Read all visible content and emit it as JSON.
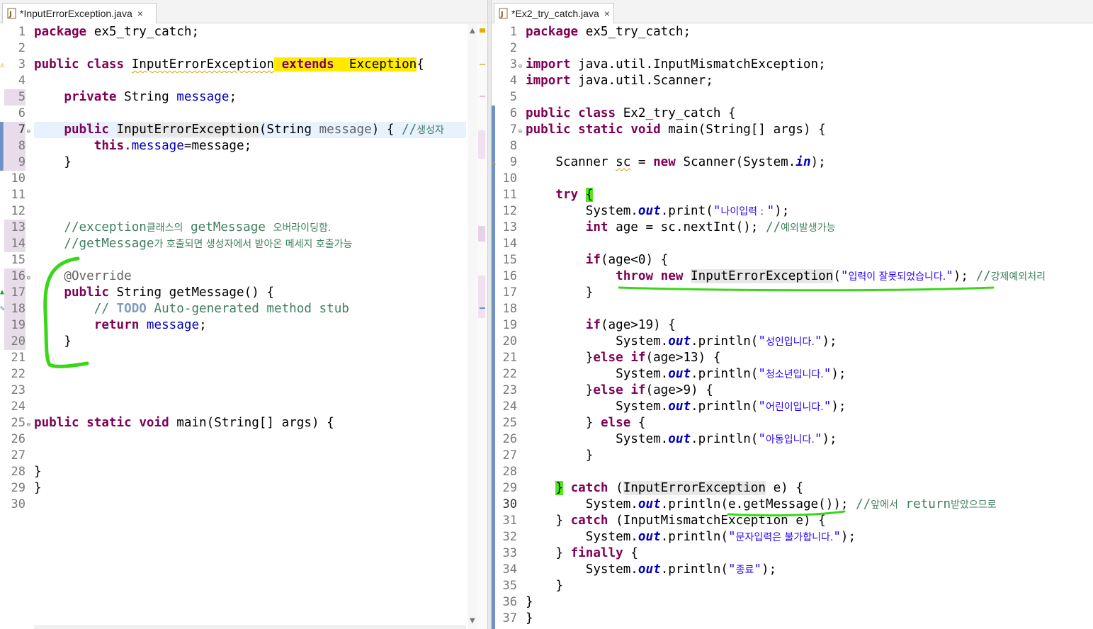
{
  "colors": {
    "keyword": "#7f0055",
    "field": "#0000c0",
    "comment": "#3f7f5f",
    "string": "#2a00ff",
    "annotation_highlight": "#50e81c",
    "occurrence_highlight": "#ffea00"
  },
  "left": {
    "tab": {
      "title": "*InputErrorException.java",
      "icon": "java-file-icon",
      "close": "×"
    },
    "line_numbers": [
      "1",
      "2",
      "3",
      "4",
      "5",
      "6",
      "7",
      "8",
      "9",
      "10",
      "11",
      "12",
      "13",
      "14",
      "15",
      "16",
      "17",
      "18",
      "19",
      "20",
      "21",
      "22",
      "23",
      "24",
      "25",
      "26",
      "27",
      "28",
      "29",
      "30"
    ],
    "code": {
      "l1_kw": "package",
      "l1_rest": " ex5_try_catch;",
      "l3_kw1": "public",
      "l3_kw2": "class",
      "l3_name": "InputErrorException",
      "l3_extends": "extends",
      "l3_exc": "Exception",
      "l3_brace": "{",
      "l5_kw": "private",
      "l5_type": " String ",
      "l5_field": "message",
      "l5_end": ";",
      "l7_kw": "public",
      "l7_name": "InputErrorException",
      "l7_params": "(String ",
      "l7_param": "message",
      "l7_close": ") { ",
      "l7_comment_slash": "//",
      "l7_comment_ko": "생성자",
      "l8_this": "this",
      "l8_dot": ".",
      "l8_field": "message",
      "l8_eq": "=message;",
      "l9": "}",
      "l13_prefix": "//exception",
      "l13_ko1": "클래스의",
      "l13_mid": " getMessage ",
      "l13_ko2": "오버라이딩함.",
      "l14_prefix": "//getMessage",
      "l14_ko": "가 호출되면 생성자에서 받아온 메세지 호출가능",
      "l16": "@Override",
      "l17_kw": "public",
      "l17_rest": " String getMessage() {",
      "l18_slash": "// ",
      "l18_todo": "TODO",
      "l18_rest": " Auto-generated method stub",
      "l19_kw": "return",
      "l19_field": "message",
      "l19_end": ";",
      "l20": "}",
      "l25_kw1": "public",
      "l25_kw2": "static",
      "l25_kw3": "void",
      "l25_rest": " main(String[] args) {",
      "l28": "}",
      "l29": "}"
    }
  },
  "right": {
    "tab": {
      "title": "*Ex2_try_catch.java",
      "icon": "java-file-icon",
      "close": "×"
    },
    "line_numbers": [
      "1",
      "2",
      "3",
      "4",
      "5",
      "6",
      "7",
      "8",
      "9",
      "10",
      "11",
      "12",
      "13",
      "14",
      "15",
      "16",
      "17",
      "18",
      "19",
      "20",
      "21",
      "22",
      "23",
      "24",
      "25",
      "26",
      "27",
      "28",
      "29",
      "30",
      "31",
      "32",
      "33",
      "34",
      "35",
      "36",
      "37"
    ],
    "code": {
      "l1_kw": "package",
      "l1_rest": " ex5_try_catch;",
      "l3_kw": "import",
      "l3_rest": " java.util.InputMismatchException;",
      "l4_kw": "import",
      "l4_rest": " java.util.Scanner;",
      "l6_kw1": "public",
      "l6_kw2": "class",
      "l6_rest": " Ex2_try_catch {",
      "l7_kw1": "public",
      "l7_kw2": "static",
      "l7_kw3": "void",
      "l7_rest": " main(String[] args) {",
      "l9_a": "Scanner ",
      "l9_var": "sc",
      "l9_b": " = ",
      "l9_new": "new",
      "l9_c": " Scanner(System.",
      "l9_in": "in",
      "l9_d": ");",
      "l11_try": "try",
      "l11_brace": "{",
      "l12_a": "System.",
      "l12_out": "out",
      "l12_b": ".print(",
      "l12_str_q": "\"",
      "l12_str_ko": "나이입력 : ",
      "l12_str_q2": "\"",
      "l12_c": ");",
      "l13_kw": "int",
      "l13_a": " age = sc.nextInt(); ",
      "l13_slash": "//",
      "l13_ko": "예외발생가능",
      "l15_kw": "if",
      "l15_a": "(age<0) {",
      "l16_kw1": "throw",
      "l16_kw2": "new",
      "l16_name": "InputErrorException",
      "l16_open": "(",
      "l16_q": "\"",
      "l16_ko": "입력이 잘못되었습니다.",
      "l16_q2": "\"",
      "l16_close": "); ",
      "l16_slash": "//",
      "l16_cko": "강제예외처리",
      "l17": "}",
      "l19_kw": "if",
      "l19_a": "(age>19) {",
      "l20_a": "System.",
      "l20_out": "out",
      "l20_b": ".println(",
      "l20_q": "\"",
      "l20_ko": "성인입니다.",
      "l20_q2": "\"",
      "l20_c": ");",
      "l21_a": "}",
      "l21_kw1": "else",
      "l21_kw2": "if",
      "l21_b": "(age>13) {",
      "l22_a": "System.",
      "l22_out": "out",
      "l22_b": ".println(",
      "l22_q": "\"",
      "l22_ko": "청소년입니다.",
      "l22_q2": "\"",
      "l22_c": ");",
      "l23_a": "}",
      "l23_kw1": "else",
      "l23_kw2": "if",
      "l23_b": "(age>9) {",
      "l24_a": "System.",
      "l24_out": "out",
      "l24_b": ".println(",
      "l24_q": "\"",
      "l24_ko": "어린이입니다.",
      "l24_q2": "\"",
      "l24_c": ");",
      "l25_a": "} ",
      "l25_kw": "else",
      "l25_b": " {",
      "l26_a": "System.",
      "l26_out": "out",
      "l26_b": ".println(",
      "l26_q": "\"",
      "l26_ko": "아동입니다.",
      "l26_q2": "\"",
      "l26_c": ");",
      "l27": "}",
      "l29_brace": "}",
      "l29_kw": "catch",
      "l29_a": " (",
      "l29_name": "InputErrorException",
      "l29_b": " e) {",
      "l30_a": "System.",
      "l30_out": "out",
      "l30_b": ".println(",
      "l30_c": "e.getMessage()",
      "l30_d": "); ",
      "l30_slash": "//",
      "l30_ko1": "앞에서",
      "l30_ret": " return",
      "l30_ko2": "받았으므로",
      "l31_a": "} ",
      "l31_kw": "catch",
      "l31_b": " (InputMismatchException e) {",
      "l32_a": "System.",
      "l32_out": "out",
      "l32_b": ".println(",
      "l32_q": "\"",
      "l32_ko": "문자입력은 불가합니다.",
      "l32_q2": "\"",
      "l32_c": ");",
      "l33_a": "} ",
      "l33_kw": "finally",
      "l33_b": " {",
      "l34_a": "System.",
      "l34_out": "out",
      "l34_b": ".println(",
      "l34_q": "\"",
      "l34_ko": "종료",
      "l34_q2": "\"",
      "l34_c": ");",
      "l35": "}",
      "l36": "}",
      "l37": "}"
    }
  }
}
